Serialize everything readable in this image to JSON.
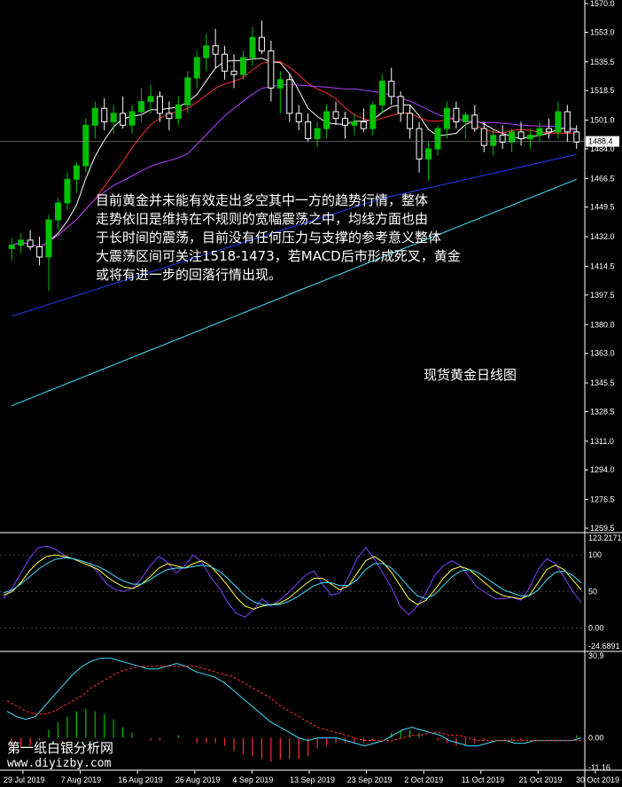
{
  "annotation": "目前黄金并未能有效走出多空其中一方的趋势行情，整体\n走势依旧是维持在不规则的宽幅震荡之中，均线方面也由\n于长时间的震荡，目前没有任何压力与支撑的参考意义整体\n大震荡区间可关注1518-1473，若MACD后市形成死叉，黄金\n或将有进一步的回落行情出现。",
  "subtitle": "现货黄金日线图",
  "watermark": {
    "line1": "第一纸白银分析网",
    "line2": "www.diyizby.com"
  },
  "colors": {
    "up": "#00c000",
    "down": "#ffffff",
    "ma_fast": "#ffffff",
    "ma_mid": "#ff3030",
    "ma_slow": "#b040ff",
    "ma_long": "#2040ff",
    "ma_200": "#40e0ff",
    "stoch_main": "#8040ff",
    "stoch_signal": "#ffff40",
    "stoch_slow": "#40e0ff",
    "macd_line": "#40e0ff",
    "macd_signal": "#ff3030"
  },
  "chart_data": [
    {
      "type": "candlestick",
      "price_ticks": [
        "1570.0",
        "1553.0",
        "1535.5",
        "1518.5",
        "1501.0",
        "1484.0",
        "1466.5",
        "1449.5",
        "1432.0",
        "1414.5",
        "1397.5",
        "1380.0",
        "1363.0",
        "1345.5",
        "1328.5",
        "1311.0",
        "1294.0",
        "1276.5",
        "1259.5"
      ],
      "current_price": "1488.4",
      "ylim": [
        1259.5,
        1570.0
      ],
      "x_labels": [
        "29 Jul 2019",
        "7 Aug 2019",
        "16 Aug 2019",
        "26 Aug 2019",
        "4 Sep 2019",
        "13 Sep 2019",
        "23 Sep 2019",
        "2 Oct 2019",
        "11 Oct 2019",
        "21 Oct 2019",
        "30 Oct 2019"
      ],
      "candles": [
        [
          1425,
          1431,
          1418,
          1427
        ],
        [
          1427,
          1434,
          1422,
          1430
        ],
        [
          1430,
          1436,
          1424,
          1426
        ],
        [
          1426,
          1432,
          1415,
          1420
        ],
        [
          1420,
          1445,
          1400,
          1442
        ],
        [
          1442,
          1455,
          1436,
          1452
        ],
        [
          1452,
          1470,
          1448,
          1466
        ],
        [
          1466,
          1476,
          1458,
          1474
        ],
        [
          1474,
          1502,
          1470,
          1498
        ],
        [
          1498,
          1512,
          1490,
          1508
        ],
        [
          1508,
          1514,
          1495,
          1500
        ],
        [
          1500,
          1510,
          1493,
          1505
        ],
        [
          1505,
          1515,
          1496,
          1498
        ],
        [
          1498,
          1510,
          1493,
          1506
        ],
        [
          1506,
          1520,
          1500,
          1512
        ],
        [
          1512,
          1522,
          1505,
          1515
        ],
        [
          1515,
          1518,
          1500,
          1505
        ],
        [
          1505,
          1512,
          1495,
          1502
        ],
        [
          1502,
          1515,
          1498,
          1510
        ],
        [
          1510,
          1530,
          1505,
          1526
        ],
        [
          1526,
          1542,
          1520,
          1538
        ],
        [
          1538,
          1552,
          1530,
          1545
        ],
        [
          1545,
          1555,
          1532,
          1540
        ],
        [
          1540,
          1545,
          1525,
          1530
        ],
        [
          1530,
          1540,
          1520,
          1528
        ],
        [
          1528,
          1542,
          1525,
          1538
        ],
        [
          1538,
          1556,
          1533,
          1550
        ],
        [
          1550,
          1560,
          1540,
          1542
        ],
        [
          1542,
          1548,
          1512,
          1520
        ],
        [
          1520,
          1530,
          1505,
          1525
        ],
        [
          1525,
          1528,
          1500,
          1505
        ],
        [
          1505,
          1510,
          1495,
          1500
        ],
        [
          1500,
          1505,
          1488,
          1490
        ],
        [
          1490,
          1500,
          1485,
          1496
        ],
        [
          1496,
          1510,
          1490,
          1506
        ],
        [
          1506,
          1512,
          1498,
          1502
        ],
        [
          1502,
          1506,
          1490,
          1498
        ],
        [
          1498,
          1505,
          1492,
          1500
        ],
        [
          1500,
          1508,
          1494,
          1496
        ],
        [
          1496,
          1512,
          1492,
          1510
        ],
        [
          1510,
          1528,
          1505,
          1524
        ],
        [
          1524,
          1532,
          1510,
          1515
        ],
        [
          1515,
          1518,
          1500,
          1505
        ],
        [
          1505,
          1510,
          1490,
          1496
        ],
        [
          1496,
          1500,
          1470,
          1478
        ],
        [
          1478,
          1488,
          1465,
          1484
        ],
        [
          1484,
          1498,
          1480,
          1496
        ],
        [
          1496,
          1512,
          1490,
          1508
        ],
        [
          1508,
          1512,
          1496,
          1500
        ],
        [
          1500,
          1506,
          1490,
          1504
        ],
        [
          1504,
          1510,
          1494,
          1496
        ],
        [
          1496,
          1500,
          1482,
          1486
        ],
        [
          1486,
          1495,
          1480,
          1492
        ],
        [
          1492,
          1498,
          1484,
          1488
        ],
        [
          1488,
          1496,
          1482,
          1494
        ],
        [
          1494,
          1500,
          1486,
          1490
        ],
        [
          1490,
          1496,
          1484,
          1492
        ],
        [
          1492,
          1500,
          1488,
          1496
        ],
        [
          1496,
          1502,
          1490,
          1494
        ],
        [
          1494,
          1512,
          1490,
          1506
        ],
        [
          1506,
          1510,
          1488,
          1494
        ],
        [
          1494,
          1498,
          1484,
          1488
        ]
      ]
    },
    {
      "type": "line",
      "name": "stochastic",
      "ticks": [
        "123.2171",
        "100",
        "50",
        "0.00",
        "-24.6891"
      ],
      "ylim": [
        -24.6891,
        123.2171
      ],
      "series": [
        {
          "values": [
            40,
            55,
            75,
            95,
            110,
            112,
            108,
            100,
            95,
            92,
            88,
            75,
            60,
            52,
            50,
            55,
            68,
            85,
            98,
            90,
            75,
            85,
            100,
            90,
            70,
            55,
            35,
            20,
            15,
            25,
            40,
            30,
            38,
            48,
            60,
            72,
            78,
            60,
            45,
            48,
            70,
            95,
            110,
            95,
            75,
            55,
            30,
            18,
            30,
            48,
            72,
            85,
            92,
            85,
            70,
            55,
            48,
            40,
            40,
            42,
            38,
            55,
            80,
            95,
            88,
            70,
            50,
            35
          ]
        },
        {
          "values": [
            45,
            50,
            62,
            78,
            90,
            98,
            100,
            98,
            95,
            90,
            85,
            80,
            70,
            62,
            56,
            54,
            60,
            70,
            82,
            88,
            85,
            82,
            88,
            92,
            85,
            72,
            58,
            42,
            30,
            26,
            30,
            32,
            34,
            40,
            50,
            60,
            68,
            68,
            60,
            52,
            58,
            75,
            92,
            98,
            90,
            76,
            58,
            40,
            32,
            38,
            52,
            68,
            80,
            84,
            80,
            70,
            60,
            50,
            44,
            42,
            40,
            45,
            62,
            80,
            86,
            80,
            66,
            52
          ]
        },
        {
          "values": [
            48,
            52,
            60,
            70,
            80,
            88,
            94,
            96,
            95,
            92,
            88,
            84,
            78,
            70,
            64,
            60,
            60,
            66,
            74,
            80,
            82,
            82,
            84,
            86,
            84,
            78,
            68,
            56,
            44,
            36,
            32,
            32,
            32,
            36,
            42,
            50,
            58,
            62,
            62,
            58,
            58,
            66,
            80,
            88,
            88,
            82,
            70,
            56,
            44,
            40,
            46,
            58,
            70,
            78,
            80,
            76,
            68,
            60,
            52,
            48,
            44,
            44,
            52,
            66,
            76,
            78,
            72,
            62
          ]
        }
      ]
    },
    {
      "type": "macd",
      "name": "MACD",
      "ticks": [
        "30.9",
        "0.00",
        "-11.16"
      ],
      "ylim": [
        -11.16,
        30.9
      ],
      "series": [
        {
          "values": [
            10,
            8,
            7,
            8,
            12,
            16,
            20,
            24,
            27,
            29,
            30,
            30,
            29,
            28,
            27,
            26,
            26,
            27,
            28,
            27,
            25,
            24,
            23,
            21,
            18,
            15,
            12,
            9,
            6,
            4,
            2,
            0,
            -1,
            0,
            0,
            0,
            -1,
            -2,
            -3,
            -2,
            -1,
            1,
            3,
            4,
            3,
            2,
            1,
            -1,
            -2,
            -3,
            -3,
            -2,
            -1,
            -1,
            -2,
            -2,
            -1,
            -1,
            -1,
            -1,
            -1,
            0
          ]
        },
        {
          "values": [
            14,
            12,
            10,
            9,
            9,
            10,
            12,
            14,
            16,
            19,
            21,
            23,
            25,
            26,
            27,
            27,
            27,
            27,
            27,
            27,
            27,
            26,
            25,
            24,
            23,
            21,
            19,
            17,
            15,
            12,
            10,
            8,
            6,
            4,
            3,
            2,
            1,
            0,
            -1,
            -1,
            -1,
            -1,
            0,
            1,
            1,
            2,
            2,
            1,
            1,
            0,
            -1,
            -1,
            -1,
            -1,
            -1,
            -1,
            -1,
            -1,
            -1,
            -1,
            -1,
            -1
          ]
        },
        {
          "values": [
            -4,
            -4,
            -3,
            -1,
            3,
            6,
            8,
            10,
            11,
            10,
            9,
            7,
            4,
            2,
            0,
            -1,
            -1,
            0,
            1,
            0,
            -2,
            -2,
            -2,
            -3,
            -5,
            -6,
            -7,
            -8,
            -9,
            -8,
            -8,
            -8,
            -7,
            -4,
            -3,
            -2,
            -2,
            -2,
            -2,
            -1,
            0,
            2,
            3,
            3,
            2,
            0,
            -1,
            -2,
            -3,
            -3,
            -2,
            -1,
            0,
            0,
            -1,
            -1,
            0,
            0,
            0,
            0,
            0,
            1
          ]
        }
      ]
    }
  ]
}
